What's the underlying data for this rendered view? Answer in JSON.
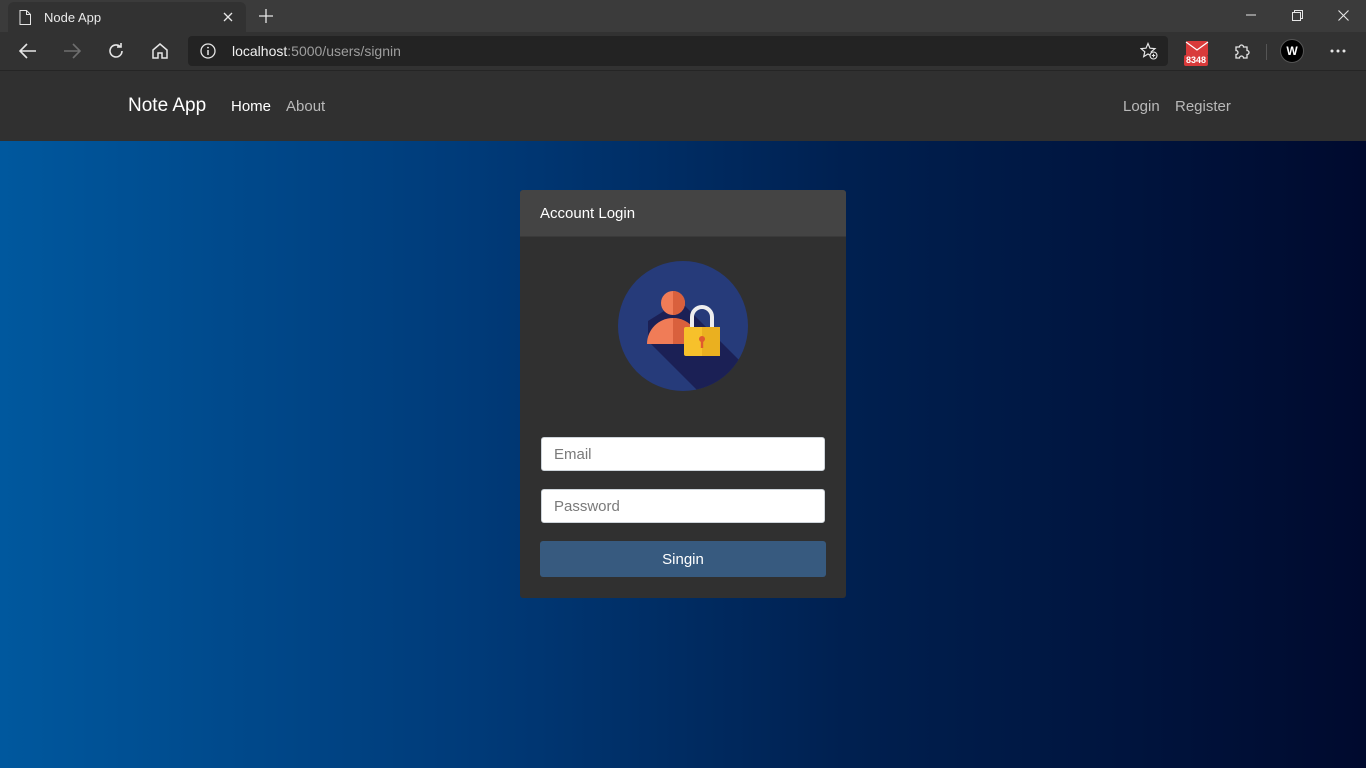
{
  "browser": {
    "tab_title": "Node App",
    "url_host": "localhost",
    "url_rest": ":5000/users/signin",
    "mail_badge": "8348",
    "profile_initial": "W"
  },
  "nav": {
    "brand": "Note App",
    "links": [
      "Home",
      "About"
    ],
    "right_links": [
      "Login",
      "Register"
    ]
  },
  "login": {
    "header": "Account Login",
    "email_placeholder": "Email",
    "password_placeholder": "Password",
    "submit_label": "Singin"
  },
  "colors": {
    "button": "#375a7f",
    "card": "#303030",
    "navbar": "#303030"
  }
}
